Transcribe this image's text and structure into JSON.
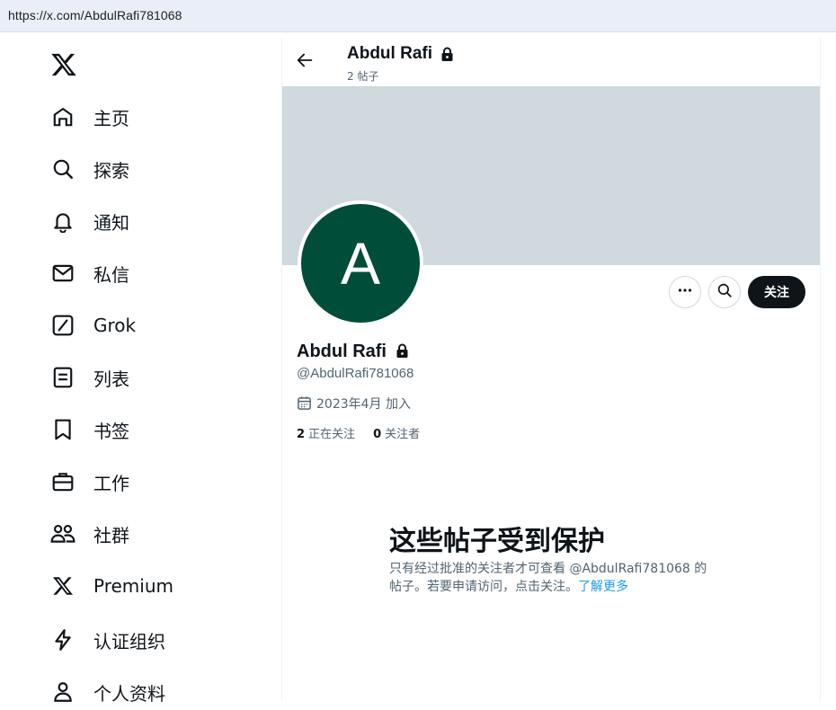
{
  "browser": {
    "url": "https://x.com/AbdulRafi781068"
  },
  "sidebar": {
    "logo_icon": "x-logo-icon",
    "items": [
      {
        "label": "主页",
        "icon": "home-icon"
      },
      {
        "label": "探索",
        "icon": "search-icon"
      },
      {
        "label": "通知",
        "icon": "bell-icon"
      },
      {
        "label": "私信",
        "icon": "mail-icon"
      },
      {
        "label": "Grok",
        "icon": "grok-icon"
      },
      {
        "label": "列表",
        "icon": "list-icon"
      },
      {
        "label": "书签",
        "icon": "bookmark-icon"
      },
      {
        "label": "工作",
        "icon": "briefcase-icon"
      },
      {
        "label": "社群",
        "icon": "communities-icon"
      },
      {
        "label": "Premium",
        "icon": "x-logo-icon"
      },
      {
        "label": "认证组织",
        "icon": "lightning-icon"
      },
      {
        "label": "个人资料",
        "icon": "person-icon"
      }
    ]
  },
  "header": {
    "name": "Abdul Rafi",
    "posts_count": "2 帖子"
  },
  "profile": {
    "avatar_letter": "A",
    "avatar_color": "#004d3a",
    "banner_color": "#cfd9de",
    "name": "Abdul Rafi",
    "handle": "@AbdulRafi781068",
    "joined": "2023年4月 加入",
    "following_count": "2",
    "following_label": "正在关注",
    "followers_count": "0",
    "followers_label": "关注者",
    "follow_button": "关注"
  },
  "protected": {
    "title": "这些帖子受到保护",
    "body": "只有经过批准的关注者才可查看 @AbdulRafi781068 的帖子。若要申请访问，点击关注。",
    "learn_more": "了解更多",
    "link_color": "#1d9bf0"
  }
}
